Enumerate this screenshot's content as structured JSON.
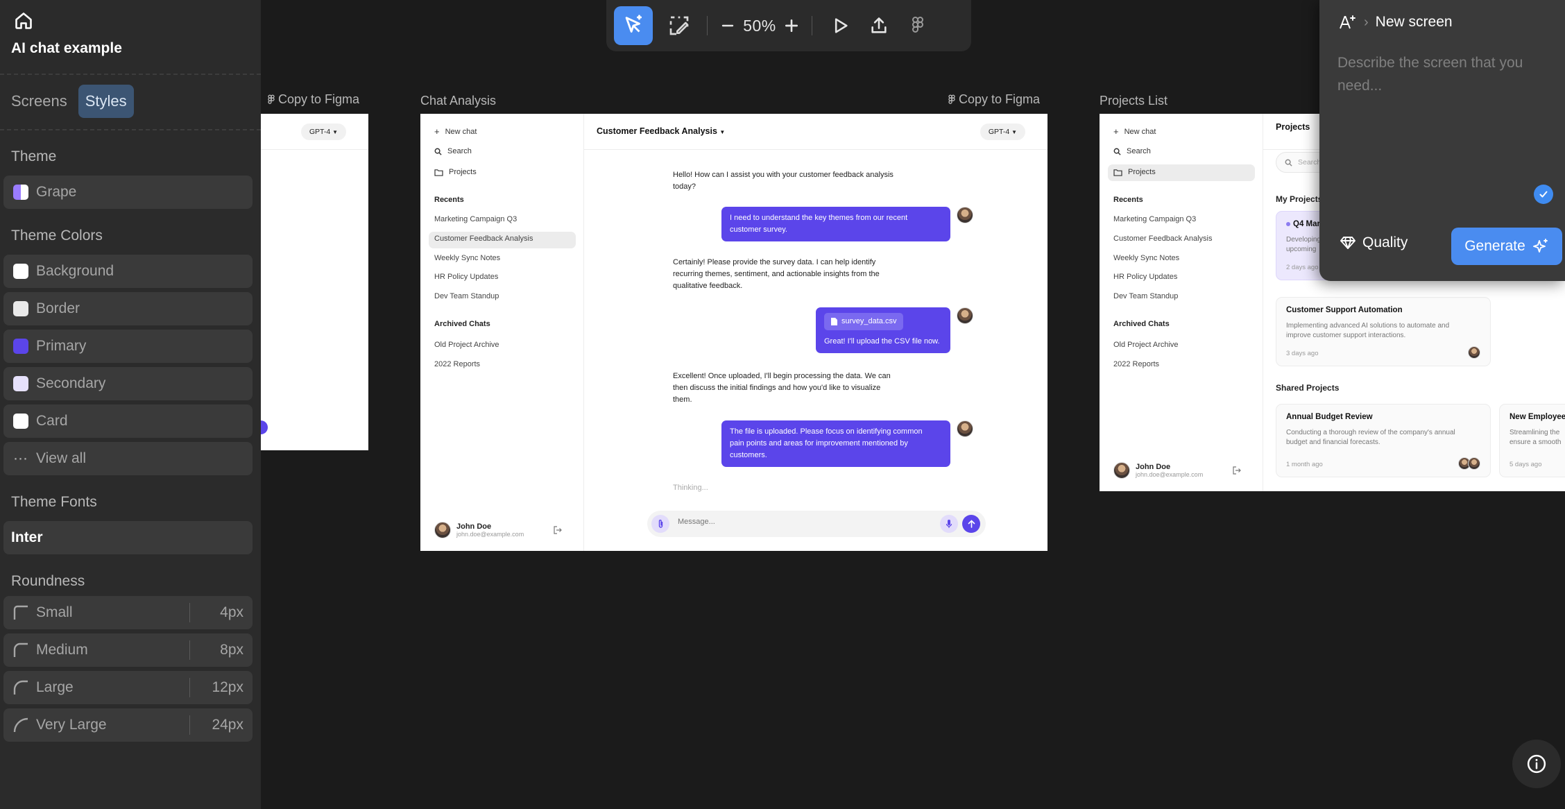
{
  "sidebar": {
    "project_title": "AI chat example",
    "tabs": [
      {
        "label": "Screens",
        "active": false
      },
      {
        "label": "Styles",
        "active": true
      }
    ],
    "theme": {
      "label": "Theme",
      "value": "Grape",
      "accent": "#7b5cf5"
    },
    "theme_colors": {
      "label": "Theme Colors",
      "items": [
        {
          "label": "Background",
          "color": "#ffffff"
        },
        {
          "label": "Border",
          "color": "#e9e9e9"
        },
        {
          "label": "Primary",
          "color": "#5b45ea"
        },
        {
          "label": "Secondary",
          "color": "#e6e1fb"
        },
        {
          "label": "Card",
          "color": "#ffffff"
        }
      ],
      "view_all": "View all"
    },
    "theme_fonts": {
      "label": "Theme Fonts",
      "value": "Inter"
    },
    "roundness": {
      "label": "Roundness",
      "items": [
        {
          "label": "Small",
          "value": "4px"
        },
        {
          "label": "Medium",
          "value": "8px"
        },
        {
          "label": "Large",
          "value": "12px"
        },
        {
          "label": "Very Large",
          "value": "24px"
        }
      ]
    }
  },
  "toolbar": {
    "zoom": "50%",
    "icons": [
      "select-ai-icon",
      "edit-area-icon",
      "zoom-out-icon",
      "zoom-in-icon",
      "play-icon",
      "export-icon",
      "figma-icon"
    ]
  },
  "frames": {
    "copy_label": "Copy to Figma",
    "left_partial": {
      "model": "GPT-4"
    },
    "chat": {
      "label": "Chat Analysis",
      "nav": {
        "new_chat": "New chat",
        "search": "Search",
        "projects": "Projects"
      },
      "recents_label": "Recents",
      "recents": [
        "Marketing Campaign Q3",
        "Customer Feedback Analysis",
        "Weekly Sync Notes",
        "HR Policy Updates",
        "Dev Team Standup"
      ],
      "archived_label": "Archived Chats",
      "archived": [
        "Old Project Archive",
        "2022 Reports"
      ],
      "user": {
        "name": "John Doe",
        "email": "john.doe@example.com"
      },
      "title": "Customer Feedback Analysis",
      "model": "GPT-4",
      "messages": {
        "ai1_a": "Hello! How can I assist you with your customer feedback analysis",
        "ai1_b": "today?",
        "user1_a": "I need to understand the key themes from our recent",
        "user1_b": "customer survey.",
        "ai2_a": "Certainly! Please provide the survey data. I can help identify",
        "ai2_b": "recurring themes, sentiment, and actionable insights from the",
        "ai2_c": "qualitative feedback.",
        "file": "survey_data.csv",
        "user2": "Great! I'll upload the CSV file now.",
        "ai3_a": "Excellent! Once uploaded, I'll begin processing the data. We can",
        "ai3_b": "then discuss the initial findings and how you'd like to visualize",
        "ai3_c": "them.",
        "user3_a": "The file is uploaded. Please focus on identifying common",
        "user3_b": "pain points and areas for improvement mentioned by",
        "user3_c": "customers.",
        "thinking": "Thinking..."
      },
      "composer_placeholder": "Message..."
    },
    "projects": {
      "label": "Projects List",
      "header": "Projects",
      "search_placeholder": "Search",
      "my_projects": "My Projects",
      "card1_title": "Q4 Mar",
      "card1_desc_a": "Developing",
      "card1_desc_b": "upcoming",
      "card1_time": "2 days ago",
      "card2_title": "Customer Support Automation",
      "card2_desc_a": "Implementing advanced AI solutions to automate and",
      "card2_desc_b": "improve customer support interactions.",
      "card2_time": "3 days ago",
      "shared_projects": "Shared Projects",
      "card3_title": "Annual Budget Review",
      "card3_desc_a": "Conducting a thorough review of the company's annual",
      "card3_desc_b": "budget and financial forecasts.",
      "card3_time": "1 month ago",
      "card4_title": "New Employee",
      "card4_desc_a": "Streamlining the",
      "card4_desc_b": "ensure a smooth",
      "card4_time": "5 days ago"
    }
  },
  "generate_panel": {
    "title": "New screen",
    "placeholder": "Describe the screen that you need...",
    "quality_label": "Quality",
    "generate_label": "Generate"
  }
}
